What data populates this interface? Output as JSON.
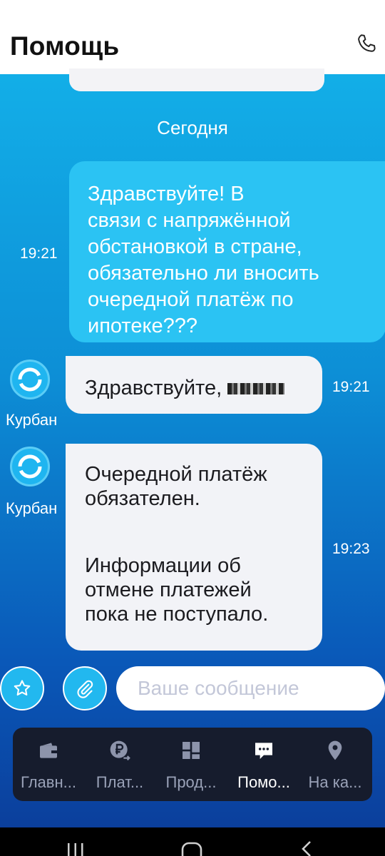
{
  "header": {
    "title": "Помощь",
    "phone_icon": "phone-icon"
  },
  "chat": {
    "date_separator": "Сегодня",
    "outgoing": {
      "text": "Здравствуйте! В\nсвязи с напряжённой\nобстановкой в стране,\nобязательно ли вносить\nочередной платёж по\nипотеке???",
      "time": "19:21"
    },
    "incoming": [
      {
        "sender": "Курбан",
        "text": "Здравствуйте,",
        "time": "19:21"
      },
      {
        "sender": "Курбан",
        "paragraph1": "Очередной платёж\nобязателен.",
        "paragraph2": "Информации об\nотмене платежей\nпока не поступало.",
        "time": "19:23"
      }
    ]
  },
  "input": {
    "placeholder": "Ваше сообщение"
  },
  "bottom_nav": {
    "items": [
      {
        "label": "Главн...",
        "icon": "wallet-icon"
      },
      {
        "label": "Плат...",
        "icon": "ruble-transfer-icon"
      },
      {
        "label": "Прод...",
        "icon": "products-grid-icon"
      },
      {
        "label": "Помо...",
        "icon": "chat-icon",
        "active": true
      },
      {
        "label": "На ка...",
        "icon": "map-pin-icon"
      }
    ]
  },
  "colors": {
    "accent": "#22b8ef",
    "nav_bg": "#161c2d",
    "bubble_out": "#2bc3f3",
    "bubble_in": "#f2f3f7"
  }
}
